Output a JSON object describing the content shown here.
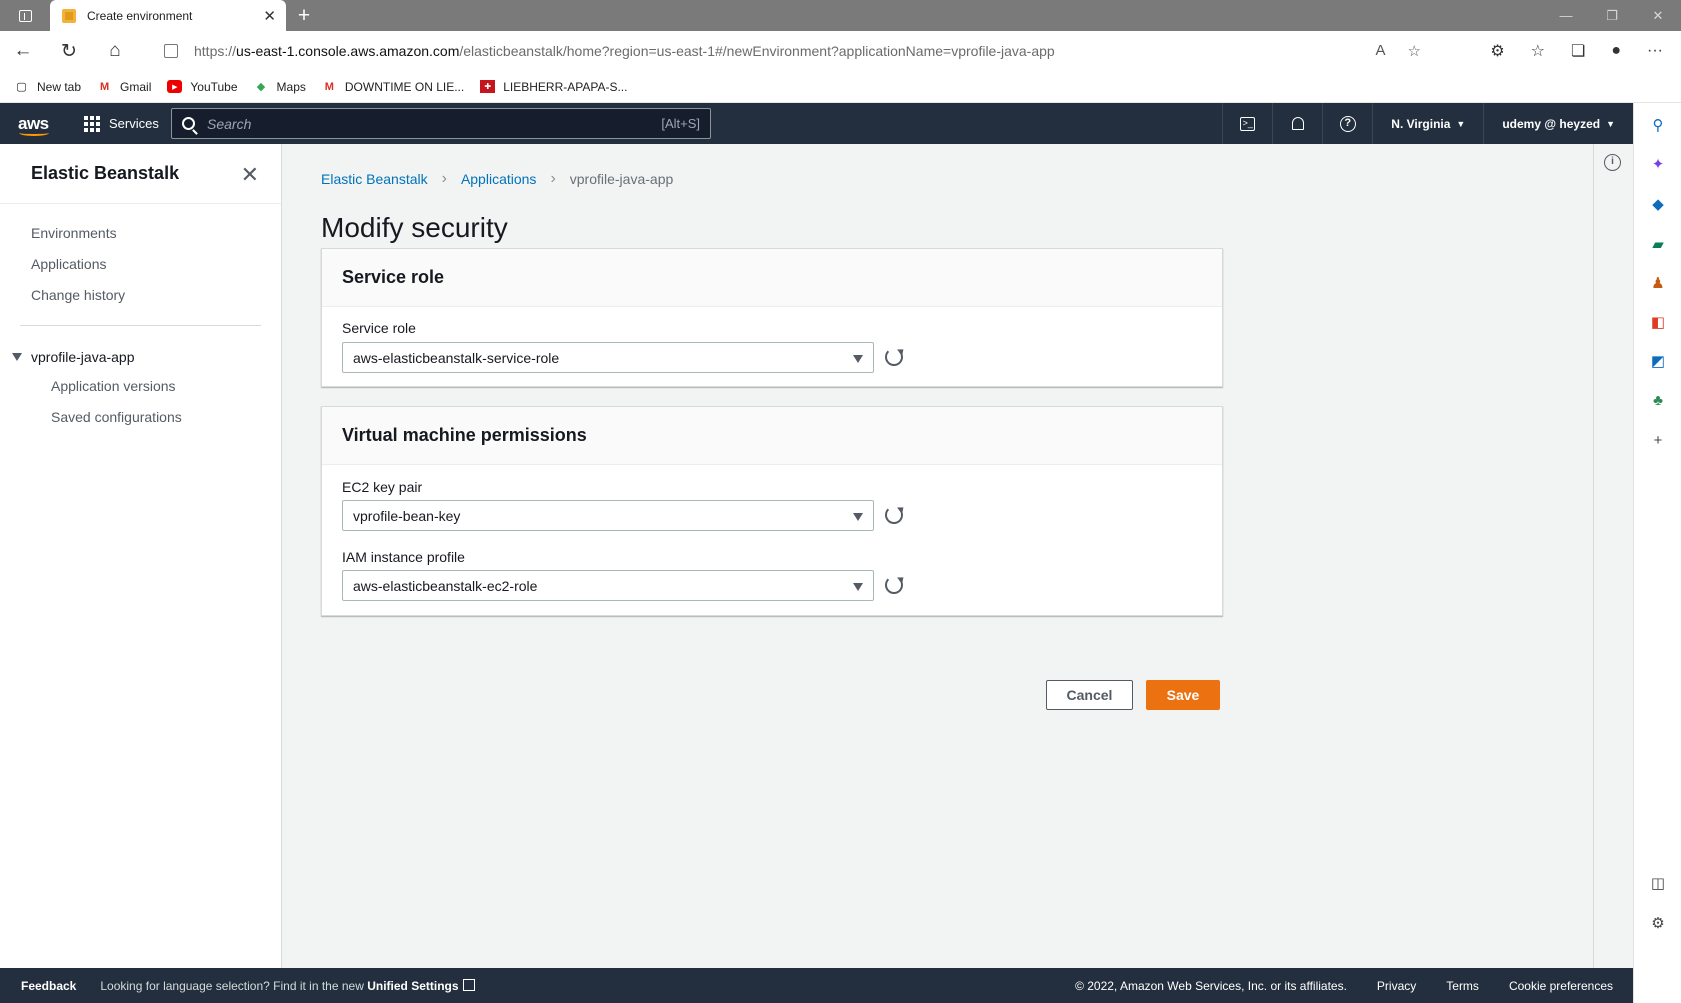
{
  "browser": {
    "tab_title": "Create environment",
    "url_prefix": "https://",
    "url_host": "us-east-1.console.aws.amazon.com",
    "url_path": "/elasticbeanstalk/home?region=us-east-1#/newEnvironment?applicationName=vprofile-java-app",
    "bookmarks": [
      "New tab",
      "Gmail",
      "YouTube",
      "Maps",
      "DOWNTIME ON LIE...",
      "LIEBHERR-APAPA-S..."
    ]
  },
  "aws_nav": {
    "services_label": "Services",
    "search_placeholder": "Search",
    "search_shortcut": "[Alt+S]",
    "region": "N. Virginia",
    "user": "udemy @ heyzed"
  },
  "sidebar": {
    "title": "Elastic Beanstalk",
    "links": [
      "Environments",
      "Applications",
      "Change history"
    ],
    "app_group": "vprofile-java-app",
    "app_links": [
      "Application versions",
      "Saved configurations"
    ]
  },
  "breadcrumb": [
    "Elastic Beanstalk",
    "Applications",
    "vprofile-java-app"
  ],
  "page": {
    "title": "Modify security"
  },
  "service_role_panel": {
    "header": "Service role",
    "field_label": "Service role",
    "field_value": "aws-elasticbeanstalk-service-role"
  },
  "vm_panel": {
    "header": "Virtual machine permissions",
    "key_pair_label": "EC2 key pair",
    "key_pair_value": "vprofile-bean-key",
    "profile_label": "IAM instance profile",
    "profile_value": "aws-elasticbeanstalk-ec2-role"
  },
  "actions": {
    "cancel": "Cancel",
    "save": "Save"
  },
  "footer": {
    "feedback": "Feedback",
    "lang_text": "Looking for language selection? Find it in the new",
    "lang_link": "Unified Settings",
    "copyright": "© 2022, Amazon Web Services, Inc. or its affiliates.",
    "privacy": "Privacy",
    "terms": "Terms",
    "cookies": "Cookie preferences"
  },
  "colors": {
    "aws_nav_bg": "#232f3e",
    "primary_button": "#ec7211",
    "link": "#0073bb"
  }
}
